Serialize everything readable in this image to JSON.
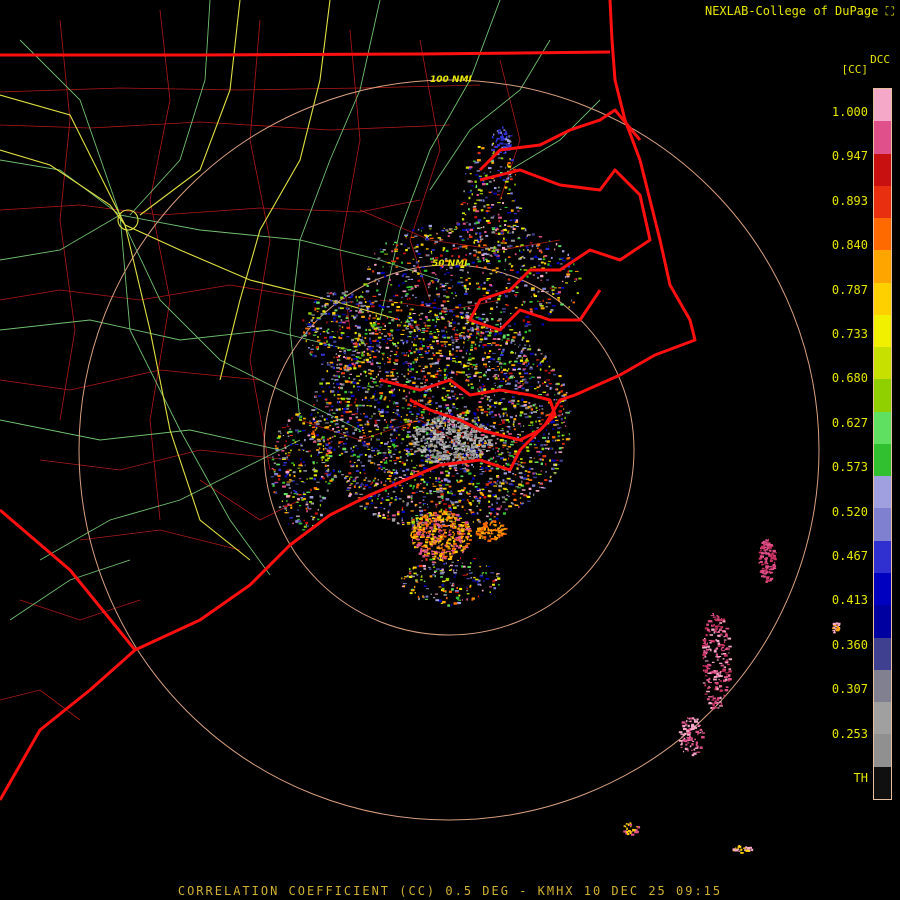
{
  "credit": "NEXLAB-College of DuPage",
  "credit_icon": "nexlab-logo-icon",
  "product_code": "DCC",
  "units": "[CC]",
  "footer": "CORRELATION COEFFICIENT (CC) 0.5 DEG - KMHX 10 DEC 25 09:15",
  "range_rings": [
    {
      "label": "100 NMI",
      "range_nmi": 100
    },
    {
      "label": "50 NMI",
      "range_nmi": 50
    }
  ],
  "colorbar": {
    "ticks": [
      "1.000",
      "0.947",
      "0.893",
      "0.840",
      "0.787",
      "0.733",
      "0.680",
      "0.627",
      "0.573",
      "0.520",
      "0.467",
      "0.413",
      "0.360",
      "0.307",
      "0.253",
      "TH"
    ],
    "colors": [
      "#f5a8c8",
      "#e0508a",
      "#c81010",
      "#e83010",
      "#ff6a00",
      "#ffa500",
      "#ffd000",
      "#f0f000",
      "#c8e000",
      "#90d000",
      "#60e060",
      "#30c030",
      "#a0a0e0",
      "#8080d0",
      "#3030d0",
      "#0000c0",
      "#0000a0",
      "#404090",
      "#808090",
      "#a0a0a0",
      "#909090",
      "#101010"
    ]
  },
  "colors": {
    "state_border": "#ff1010",
    "county_line": "#b01818",
    "highway": "#e0e040",
    "road": "#70c070",
    "range_ring": "#d8a080"
  }
}
